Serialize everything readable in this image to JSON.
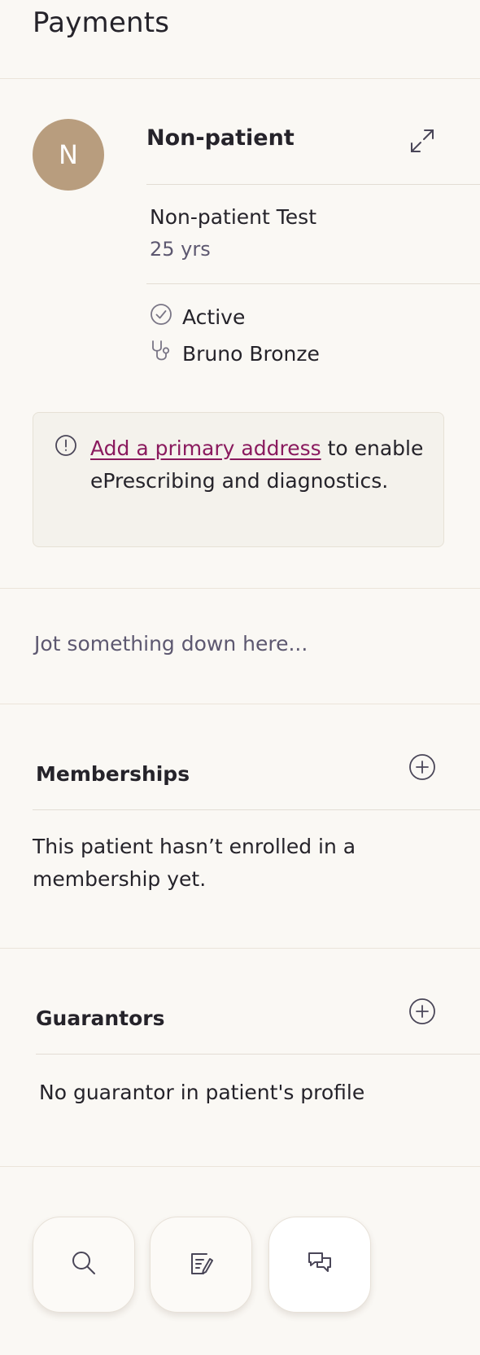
{
  "header": {
    "title": "Payments"
  },
  "patient": {
    "avatar_initial": "N",
    "display_name": "Non-patient",
    "full_name": "Non-patient Test",
    "age": "25 yrs",
    "status": "Active",
    "provider": "Bruno Bronze"
  },
  "notice": {
    "link_text": "Add a primary address",
    "text": " to enable ePrescribing and diagnostics."
  },
  "notes": {
    "placeholder": "Jot something down here..."
  },
  "memberships": {
    "title": "Memberships",
    "empty_text": "This patient hasn’t enrolled in a membership yet."
  },
  "guarantors": {
    "title": "Guarantors",
    "empty_text": "No guarantor in patient's profile"
  },
  "dock": {
    "buttons": [
      {
        "icon": "search-icon"
      },
      {
        "icon": "note-edit-icon"
      },
      {
        "icon": "chat-icon"
      }
    ]
  },
  "colors": {
    "background": "#faf8f4",
    "avatar": "#b89d7e",
    "link": "#8a1a5e",
    "muted_text": "#5d5870"
  }
}
